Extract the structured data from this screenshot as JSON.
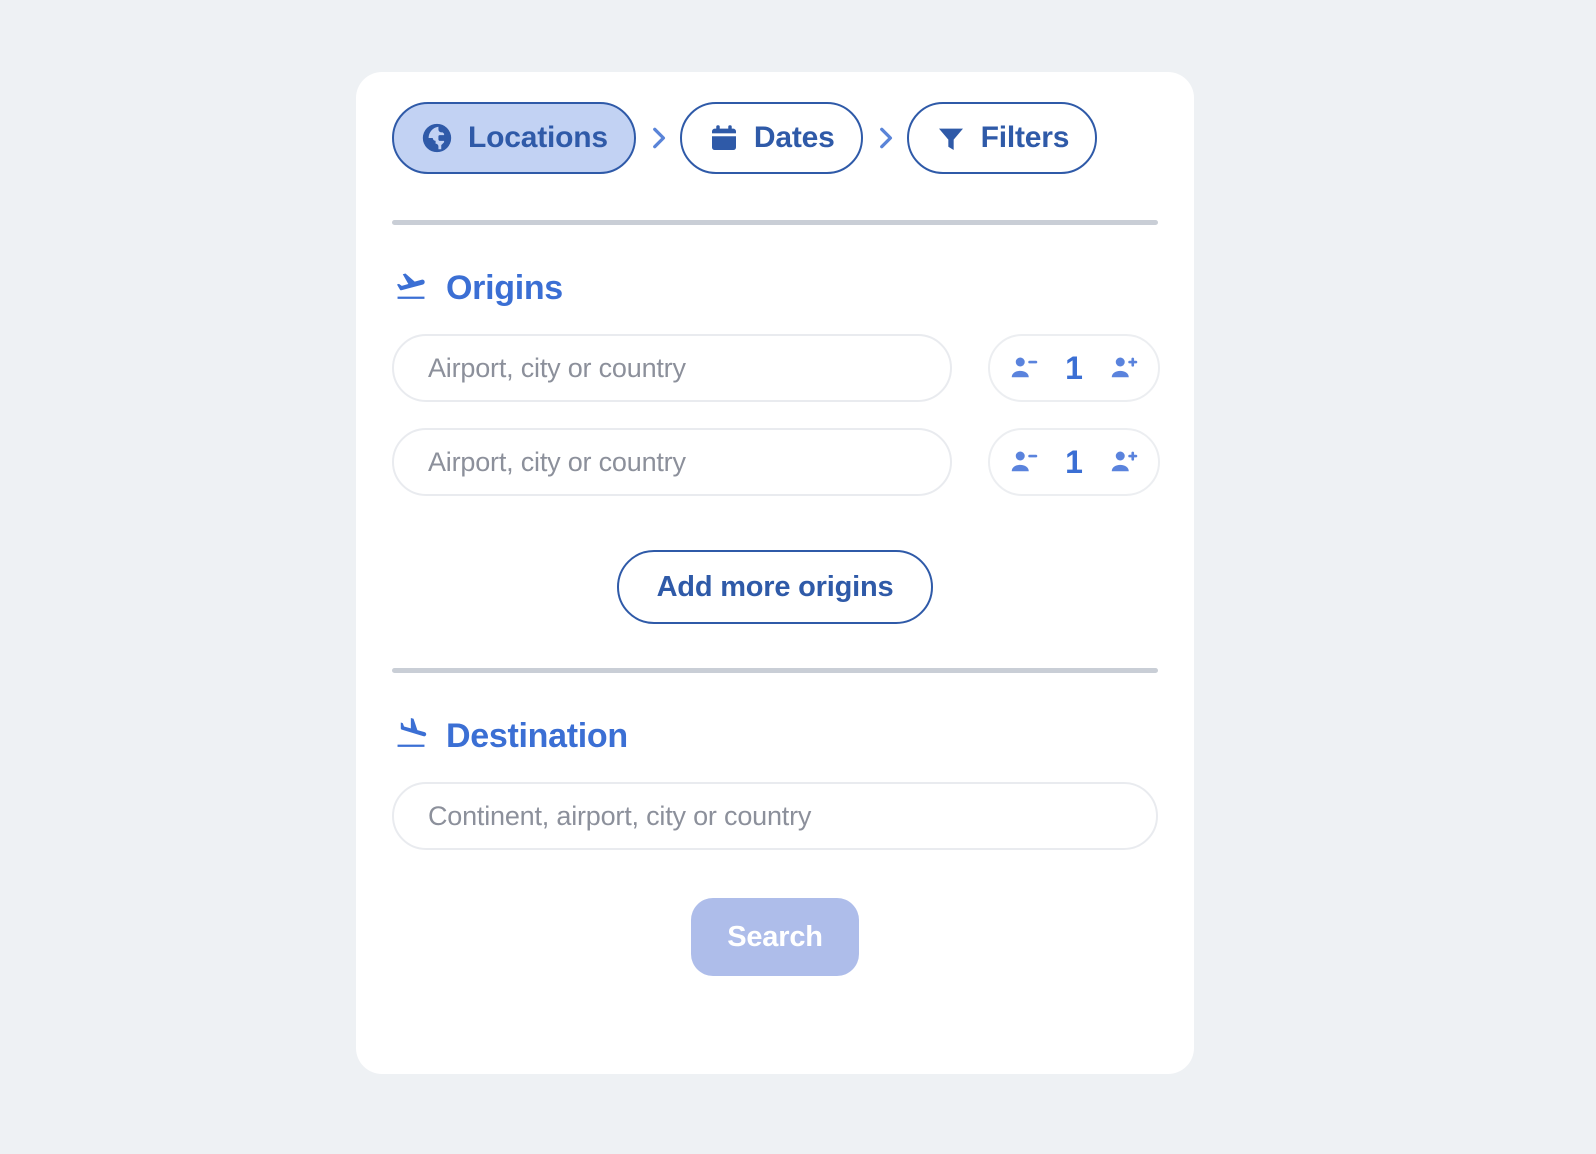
{
  "theme": {
    "page_bg": "#eef1f4",
    "card_bg": "#ffffff",
    "primary_blue": "#2f5aa8",
    "accent_blue": "#3b6fd4",
    "active_pill_bg": "#c2d2f3",
    "divider_gray": "#c9ced6",
    "placeholder_gray": "#8c909b",
    "search_disabled_bg": "#aebdea"
  },
  "stepnav": {
    "steps": [
      {
        "label": "Locations",
        "icon": "globe-icon",
        "active": true
      },
      {
        "label": "Dates",
        "icon": "calendar-icon",
        "active": false
      },
      {
        "label": "Filters",
        "icon": "funnel-icon",
        "active": false
      }
    ],
    "separator": "chevron-right-icon"
  },
  "origins": {
    "title": "Origins",
    "icon": "flight-takeoff-icon",
    "rows": [
      {
        "placeholder": "Airport, city or country",
        "value": "",
        "passengers": "1",
        "decrement_icon": "person-remove-icon",
        "increment_icon": "person-add-icon"
      },
      {
        "placeholder": "Airport, city or country",
        "value": "",
        "passengers": "1",
        "decrement_icon": "person-remove-icon",
        "increment_icon": "person-add-icon"
      }
    ],
    "add_label": "Add more origins"
  },
  "destination": {
    "title": "Destination",
    "icon": "flight-land-icon",
    "placeholder": "Continent, airport, city or country",
    "value": ""
  },
  "search": {
    "label": "Search"
  }
}
